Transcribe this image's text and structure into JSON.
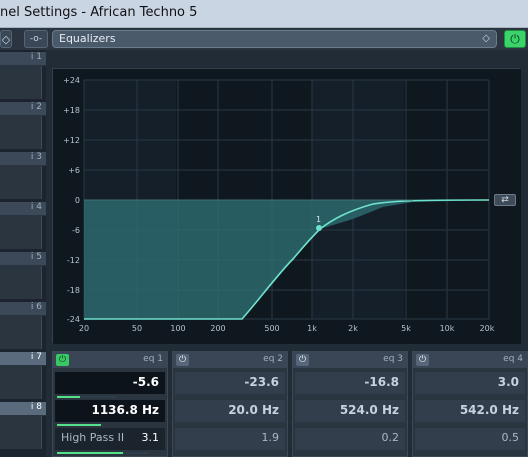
{
  "window": {
    "title": "nel Settings - African Techno 5"
  },
  "header": {
    "left_btn_glyph": "◇",
    "link_btn_glyph": "-o-",
    "eq_section_label": "Equalizers",
    "eq_diamond": "◇",
    "eq_on_glyph": "⏻"
  },
  "slots": [
    {
      "label": "i 1"
    },
    {
      "label": "i 2"
    },
    {
      "label": "i 3"
    },
    {
      "label": "i 4"
    },
    {
      "label": "i 5"
    },
    {
      "label": "i 6"
    },
    {
      "label": "i 7"
    },
    {
      "label": "i 8"
    }
  ],
  "graph": {
    "y_ticks": [
      "+24",
      "+18",
      "+12",
      "+6",
      "0",
      "-6",
      "-12",
      "-18",
      "-24"
    ],
    "x_ticks": [
      "20",
      "50",
      "100",
      "200",
      "500",
      "1k",
      "2k",
      "5k",
      "10k",
      "20k"
    ],
    "node_label": "1",
    "toggle_glyph": "⇄"
  },
  "bands": [
    {
      "name": "eq 1",
      "on": true,
      "gain": "-5.6",
      "freq": "1136.8 Hz",
      "type": "High Pass II",
      "q": "3.1",
      "gain_fraction": 0.38,
      "q_fraction": 0.72
    },
    {
      "name": "eq 2",
      "on": false,
      "gain": "-23.6",
      "freq": "20.0 Hz",
      "type": "",
      "q": "1.9"
    },
    {
      "name": "eq 3",
      "on": false,
      "gain": "-16.8",
      "freq": "524.0 Hz",
      "type": "",
      "q": "0.2"
    },
    {
      "name": "eq 4",
      "on": false,
      "gain": "3.0",
      "freq": "542.0 Hz",
      "type": "",
      "q": "0.5"
    }
  ],
  "band_power_glyph": "⏻",
  "colors": {
    "accent_green": "#3bd46a",
    "curve": "#5fd9c3",
    "curve_fill": "#2f6b6e"
  }
}
